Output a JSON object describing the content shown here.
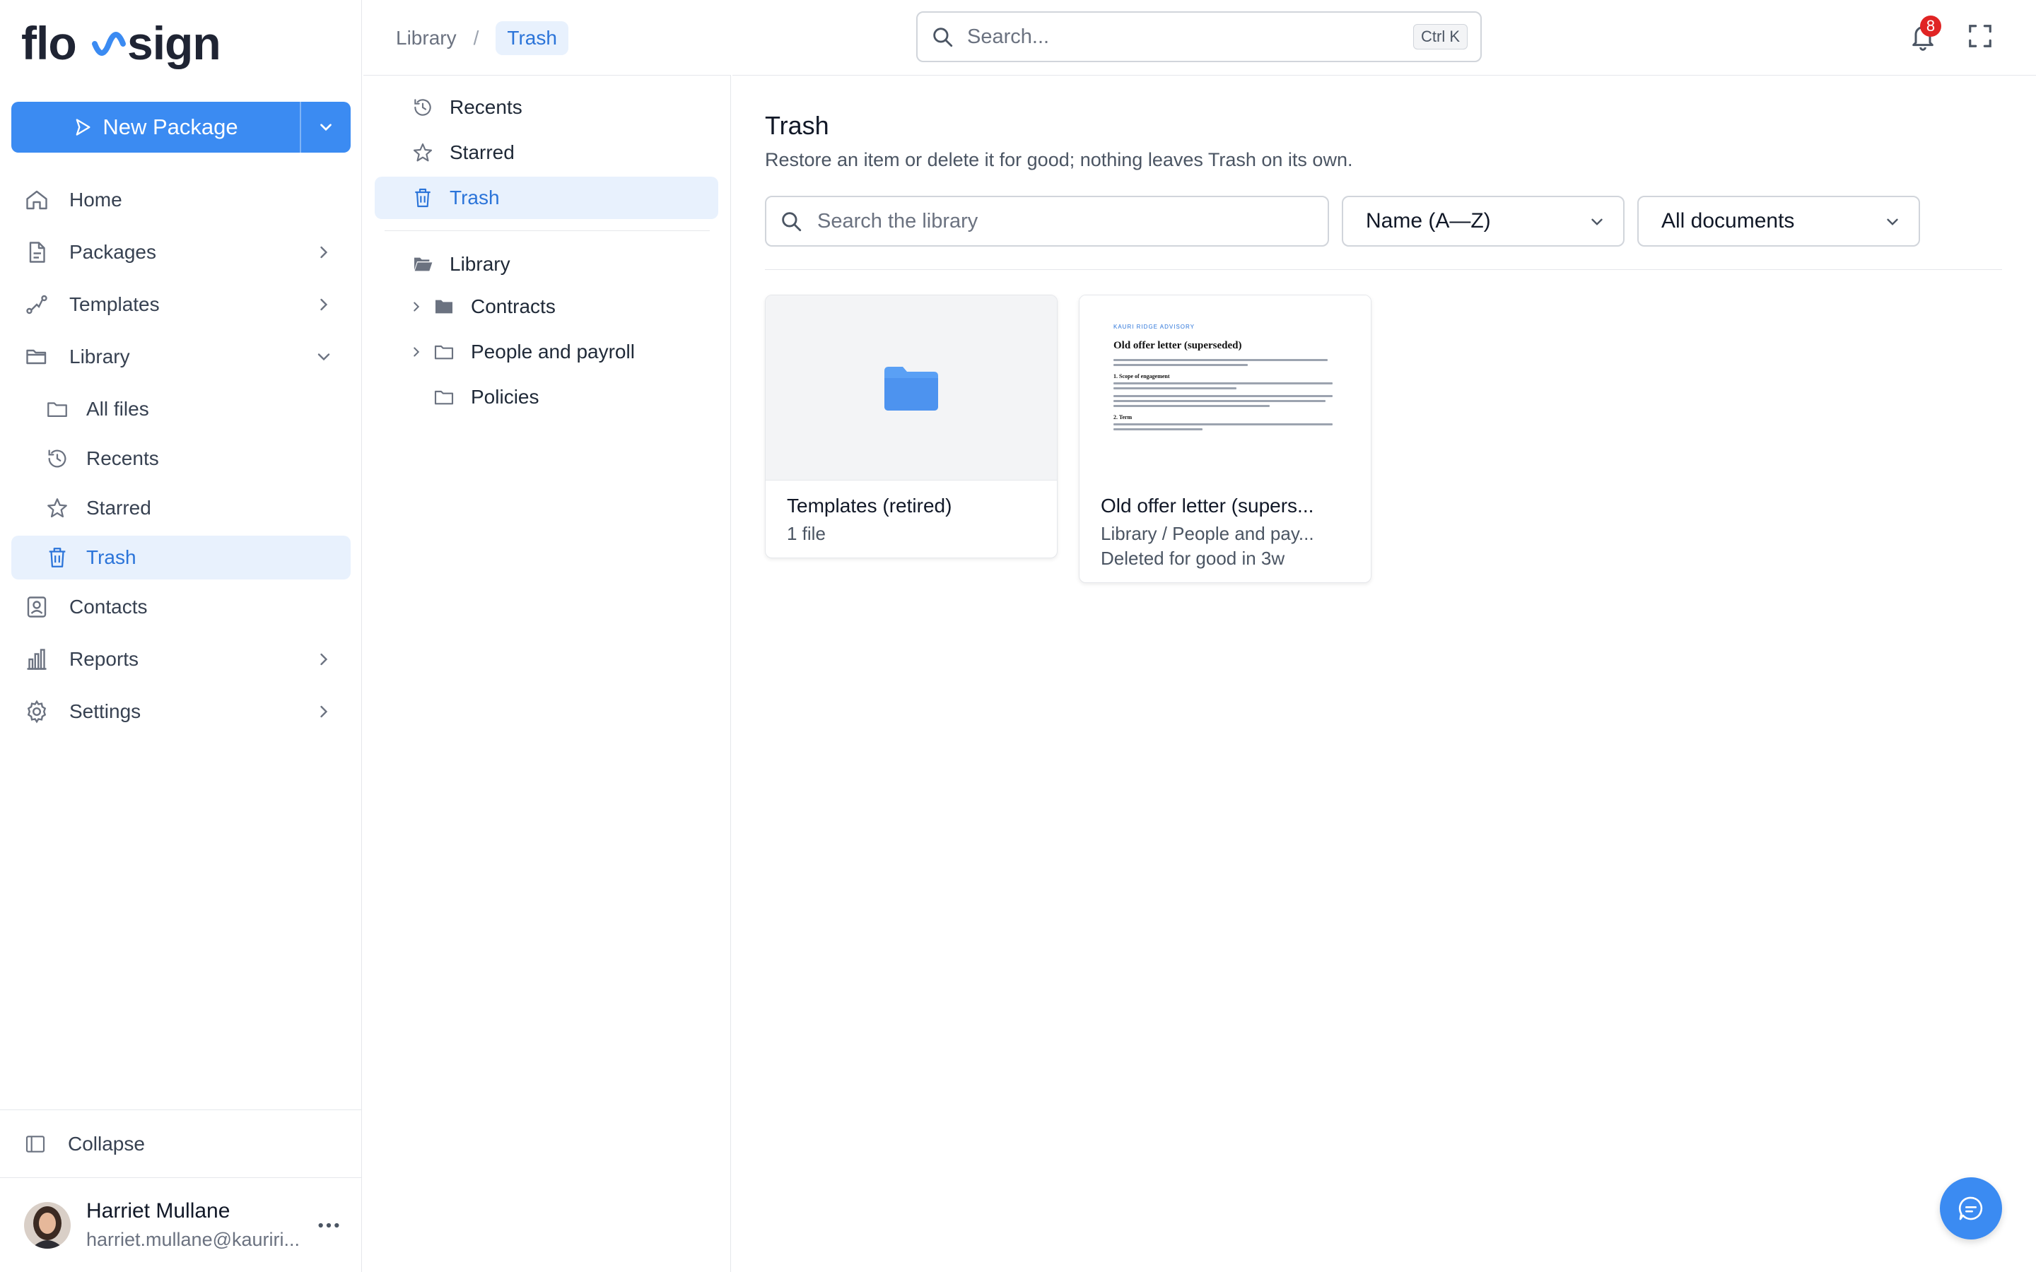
{
  "app": {
    "brand": "flowsign"
  },
  "sidebar": {
    "new_package_label": "New Package",
    "items": [
      {
        "label": "Home",
        "icon": "home-icon"
      },
      {
        "label": "Packages",
        "icon": "document-icon"
      },
      {
        "label": "Templates",
        "icon": "route-icon"
      },
      {
        "label": "Library",
        "icon": "folder-open-icon"
      }
    ],
    "library_sub": [
      {
        "label": "All files",
        "icon": "folder-icon"
      },
      {
        "label": "Recents",
        "icon": "history-icon"
      },
      {
        "label": "Starred",
        "icon": "star-icon"
      },
      {
        "label": "Trash",
        "icon": "trash-icon"
      }
    ],
    "items_after": [
      {
        "label": "Contacts",
        "icon": "contact-card-icon"
      },
      {
        "label": "Reports",
        "icon": "bar-chart-icon"
      },
      {
        "label": "Settings",
        "icon": "gear-icon"
      }
    ],
    "collapse_label": "Collapse",
    "user": {
      "name": "Harriet Mullane",
      "email": "harriet.mullane@kauriri..."
    }
  },
  "topbar": {
    "breadcrumb": [
      "Library",
      "/",
      "Trash"
    ],
    "search_placeholder": "Search...",
    "search_shortcut": "Ctrl K",
    "notification_count": "8"
  },
  "tree": {
    "quick": [
      {
        "label": "Recents",
        "icon": "history-icon"
      },
      {
        "label": "Starred",
        "icon": "star-icon"
      },
      {
        "label": "Trash",
        "icon": "trash-icon"
      }
    ],
    "root_label": "Library",
    "folders": [
      {
        "label": "Contracts",
        "expandable": true
      },
      {
        "label": "People and payroll",
        "expandable": true
      },
      {
        "label": "Policies",
        "expandable": false
      }
    ]
  },
  "main": {
    "title": "Trash",
    "subtitle": "Restore an item or delete it for good; nothing leaves Trash on its own.",
    "search_placeholder": "Search the library",
    "sort_value": "Name (A—Z)",
    "filter_value": "All documents",
    "cards": [
      {
        "title": "Templates (retired)",
        "meta": [
          "1 file"
        ],
        "kind": "folder"
      },
      {
        "title": "Old offer letter (supers...",
        "meta": [
          "Library / People and pay...",
          "Deleted for good in 3w"
        ],
        "kind": "document"
      }
    ],
    "doc_preview": {
      "brand": "KAURI RIDGE ADVISORY",
      "title": "Old offer letter (superseded)",
      "section_1": "1. Scope of engagement",
      "section_2": "2. Term"
    }
  },
  "colors": {
    "accent": "#3b8bf2",
    "active_bg": "#e8f1fd",
    "active_text": "#2b74d9",
    "badge": "#e02424"
  }
}
